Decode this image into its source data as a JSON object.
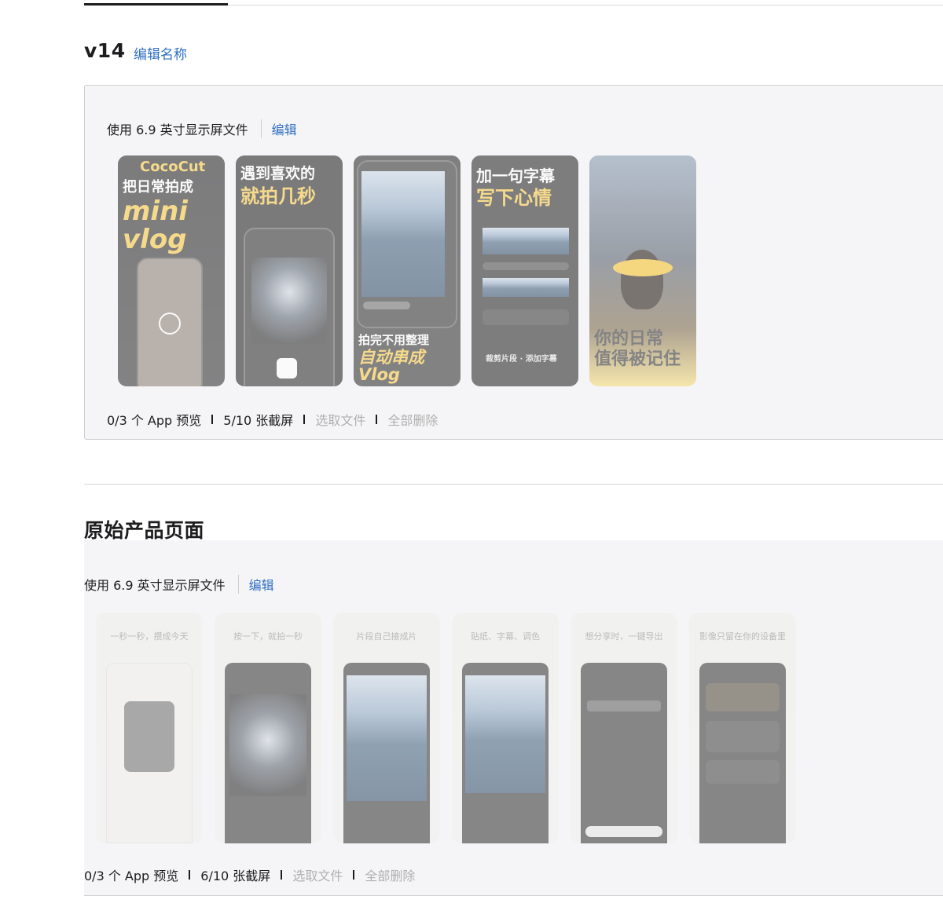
{
  "version_section": {
    "title": "v14",
    "edit_name_label": "编辑名称",
    "device_label": "使用 6.9 英寸显示屏文件",
    "edit_label": "编辑",
    "screenshots": [
      {
        "caption_top": "CocoCut",
        "caption_main": "把日常拍成",
        "caption_big": "mini vlog"
      },
      {
        "caption_main": "遇到喜欢的",
        "caption_big": "就拍几秒"
      },
      {
        "caption_main": "拍完不用整理",
        "caption_big": "自动串成Vlog"
      },
      {
        "caption_main": "加一句字幕",
        "caption_big": "写下心情",
        "caption_sub": "裁剪片段 · 添加字幕"
      },
      {
        "caption_main": "你的日常",
        "caption_big": "值得被记住"
      }
    ],
    "app_preview_count": "0/3 个 App 预览",
    "screenshot_count": "5/10 张截屏",
    "choose_file_label": "选取文件",
    "delete_all_label": "全部删除"
  },
  "original_section": {
    "title": "原始产品页面",
    "device_label": "使用 6.9 英寸显示屏文件",
    "edit_label": "编辑",
    "screenshots": [
      {
        "caption": "一秒一秒，攒成今天"
      },
      {
        "caption": "按一下，就拍一秒"
      },
      {
        "caption": "片段自己接成片"
      },
      {
        "caption": "贴纸、字幕、调色"
      },
      {
        "caption": "想分享时，一键导出"
      },
      {
        "caption": "影像只留在你的设备里"
      }
    ],
    "app_preview_count": "0/3 个 App 预览",
    "screenshot_count": "6/10 张截屏",
    "choose_file_label": "选取文件",
    "delete_all_label": "全部删除"
  },
  "colors": {
    "link": "#2f6fc1",
    "muted": "#b0b0b0",
    "accent_yellow": "#f8c53a"
  }
}
